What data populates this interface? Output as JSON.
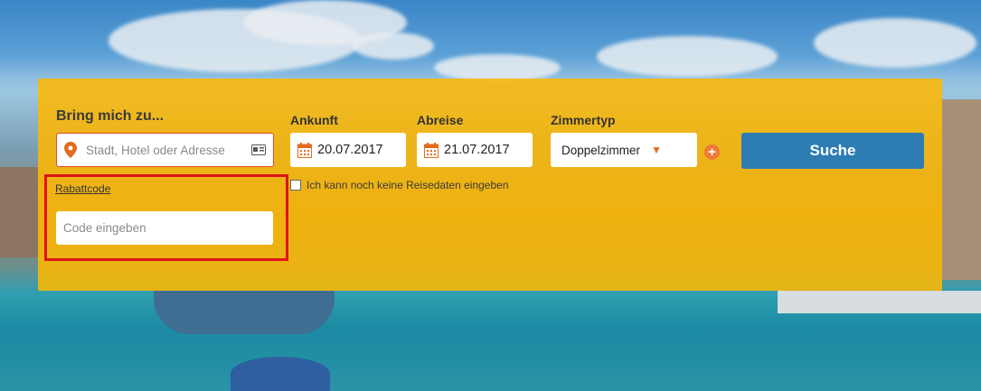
{
  "search": {
    "title": "Bring mich zu...",
    "destination_placeholder": "Stadt, Hotel oder Adresse",
    "arrival_label": "Ankunft",
    "arrival_value": "20.07.2017",
    "departure_label": "Abreise",
    "departure_value": "21.07.2017",
    "room_type_label": "Zimmertyp",
    "room_type_value": "Doppelzimmer",
    "add_room_symbol": "+",
    "search_button_label": "Suche",
    "no_dates_label": "Ich kann noch keine Reisedaten eingeben",
    "no_dates_checked": false,
    "promo_link_label": "Rabattcode",
    "promo_placeholder": "Code eingeben"
  },
  "icons": [
    "location-pin-icon",
    "contact-card-icon",
    "calendar-icon",
    "chevron-down-icon",
    "plus-circle-icon"
  ],
  "colors": {
    "panel": "#FFB800",
    "search_button": "#2D7DB3",
    "accent": "#E46A1E",
    "highlight": "#E0121B"
  }
}
